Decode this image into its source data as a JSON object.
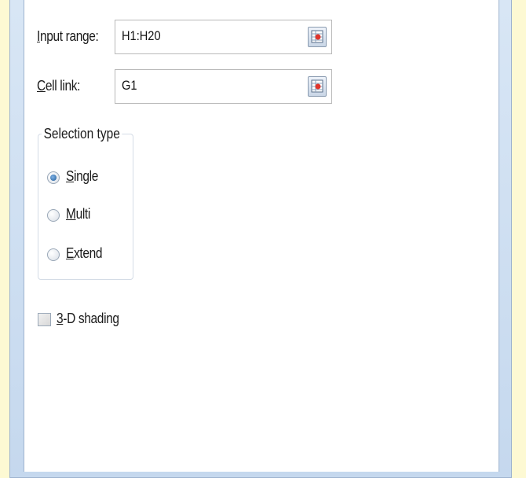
{
  "form": {
    "input_range": {
      "label": "Input range:",
      "value": "H1:H20"
    },
    "cell_link": {
      "label": "Cell link:",
      "value": "G1"
    },
    "selection_type": {
      "title": "Selection type",
      "options": [
        {
          "label": "Single",
          "checked": true
        },
        {
          "label": "Multi",
          "checked": false
        },
        {
          "label": "Extend",
          "checked": false
        }
      ]
    },
    "shading": {
      "label": "3-D shading",
      "checked": false
    }
  },
  "icons": {
    "range_picker": "collapse-dialog-icon"
  },
  "colors": {
    "background": "#fdf9d3",
    "frame": "#c5d8ee",
    "radio_selected": "#1f5a97"
  }
}
